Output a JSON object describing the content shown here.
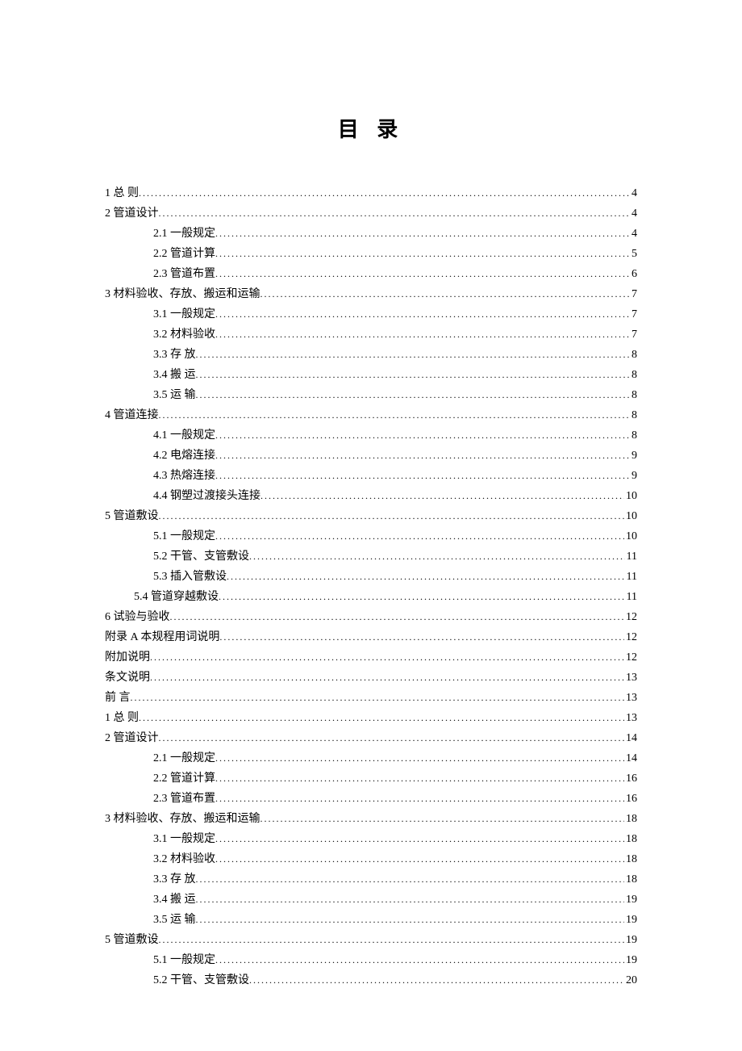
{
  "title": "目 录",
  "entries": [
    {
      "level": 1,
      "label": "1 总    则",
      "page": "4"
    },
    {
      "level": 1,
      "label": "2 管道设计",
      "page": "4"
    },
    {
      "level": 2,
      "label": "2.1 一般规定",
      "page": "4"
    },
    {
      "level": 2,
      "label": "2.2 管道计算",
      "page": "5"
    },
    {
      "level": 2,
      "label": "2.3 管道布置",
      "page": "6"
    },
    {
      "level": 1,
      "label": "3 材料验收、存放、搬运和运输",
      "page": "7"
    },
    {
      "level": 2,
      "label": "3.1 一般规定",
      "page": "7"
    },
    {
      "level": 2,
      "label": "3.2 材料验收",
      "page": "7"
    },
    {
      "level": 2,
      "label": "3.3   存   放",
      "page": "8"
    },
    {
      "level": 2,
      "label": "3.4   搬   运",
      "page": "8"
    },
    {
      "level": 2,
      "label": "3.5   运   输",
      "page": "8"
    },
    {
      "level": 1,
      "label": "4 管道连接",
      "page": "8"
    },
    {
      "level": 2,
      "label": "4.1 一般规定",
      "page": "8"
    },
    {
      "level": 2,
      "label": "4.2 电熔连接",
      "page": "9"
    },
    {
      "level": 2,
      "label": "4.3 热熔连接",
      "page": "9"
    },
    {
      "level": 2,
      "label": "4.4 钢塑过渡接头连接",
      "page": "10"
    },
    {
      "level": 1,
      "label": "5 管道敷设",
      "page": "10"
    },
    {
      "level": 2,
      "label": "5.1 一般规定",
      "page": "10"
    },
    {
      "level": 2,
      "label": "5.2 干管、支管敷设",
      "page": "11"
    },
    {
      "level": 2,
      "label": "5.3 插入管敷设",
      "page": "11"
    },
    {
      "level": "2b",
      "label": "5.4 管道穿越敷设",
      "page": "11"
    },
    {
      "level": 1,
      "label": "6 试验与验收",
      "page": "12"
    },
    {
      "level": 1,
      "label": "附录 A 本规程用词说明",
      "page": "12"
    },
    {
      "level": 1,
      "label": "附加说明",
      "page": "12"
    },
    {
      "level": 1,
      "label": "条文说明",
      "page": "13"
    },
    {
      "level": 1,
      "label": "前    言",
      "page": "13"
    },
    {
      "level": 1,
      "label": "1 总    则",
      "page": "13"
    },
    {
      "level": 1,
      "label": "2 管道设计",
      "page": "14"
    },
    {
      "level": 2,
      "label": "2.1 一般规定",
      "page": "14"
    },
    {
      "level": 2,
      "label": "2.2 管道计算",
      "page": "16"
    },
    {
      "level": 2,
      "label": "2.3 管道布置",
      "page": "16"
    },
    {
      "level": 1,
      "label": "3 材料验收、存放、搬运和运输",
      "page": "18"
    },
    {
      "level": 2,
      "label": "3.1 一般规定",
      "page": "18"
    },
    {
      "level": 2,
      "label": "3.2 材料验收",
      "page": "18"
    },
    {
      "level": 2,
      "label": "3.3 存    放",
      "page": "18"
    },
    {
      "level": 2,
      "label": "3.4 搬    运",
      "page": "19"
    },
    {
      "level": 2,
      "label": "3.5 运    输",
      "page": "19"
    },
    {
      "level": 1,
      "label": "5 管道敷设",
      "page": "19"
    },
    {
      "level": 2,
      "label": "5.1 一般规定",
      "page": "19"
    },
    {
      "level": 2,
      "label": "5.2 干管、支管敷设",
      "page": "20"
    }
  ]
}
